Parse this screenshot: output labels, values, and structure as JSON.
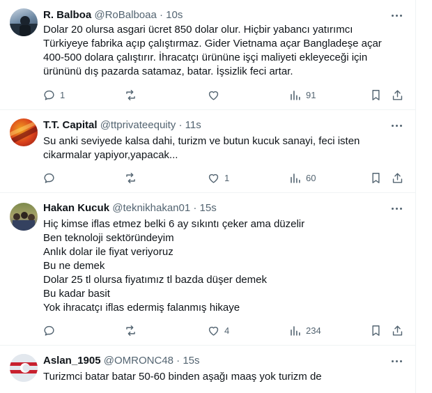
{
  "tweets": [
    {
      "name": "R. Balboa",
      "handle": "@RoBalboaa",
      "time": "10s",
      "text": "Dolar 20 olursa asgari ücret 850 dolar olur. Hiçbir yabancı yatırımcı\nTürkiyeye fabrika açıp çalıştırmaz. Gider Vietnama açar Bangladeşe açar\n400-500 dolara çalıştırır. İhracatçı ürününe işçi maliyeti ekleyeceği için\nürününü dış pazarda satamaz, batar. İşsizlik feci artar.",
      "replies": "1",
      "reposts": "",
      "likes": "",
      "views": "91"
    },
    {
      "name": "T.T. Capital",
      "handle": "@ttprivateequity",
      "time": "11s",
      "text": "Su anki seviyede kalsa dahi, turizm ve butun kucuk sanayi, feci isten\ncikarmalar yapiyor,yapacak...",
      "replies": "",
      "reposts": "",
      "likes": "1",
      "views": "60"
    },
    {
      "name": "Hakan Kucuk",
      "handle": "@teknikhakan01",
      "time": "15s",
      "text": "Hiç kimse iflas etmez belki 6 ay sıkıntı çeker ama düzelir\nBen teknoloji sektöründeyim\nAnlık dolar ile fiyat veriyoruz\nBu ne demek\nDolar 25 tl olursa fiyatımız tl bazda düşer demek\nBu kadar basit\nYok ihracatçı iflas edermiş falanmış hikaye",
      "replies": "",
      "reposts": "",
      "likes": "4",
      "views": "234"
    },
    {
      "name": "Aslan_1905",
      "handle": "@OMRONC48",
      "time": "15s",
      "text": "Turizmci batar batar 50-60 binden aşağı maaş yok turizm de"
    }
  ],
  "separator": "·",
  "colors": {
    "text": "#0f1419",
    "muted": "#536471",
    "border": "#eff3f4"
  }
}
